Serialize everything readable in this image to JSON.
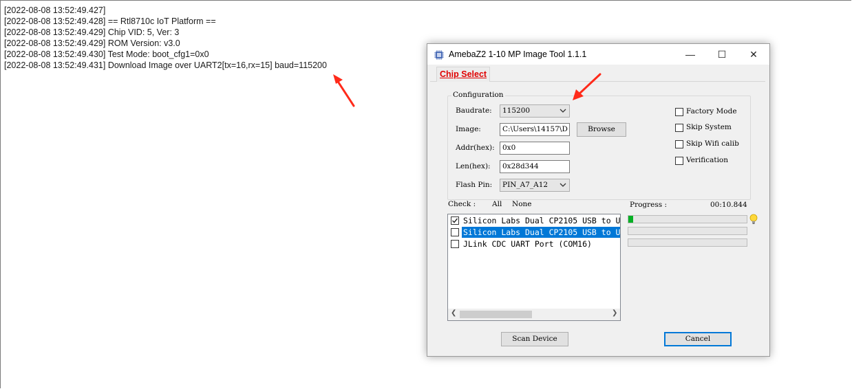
{
  "console": {
    "lines": [
      "[2022-08-08 13:52:49.427]",
      "[2022-08-08 13:52:49.428] == Rtl8710c IoT Platform ==",
      "[2022-08-08 13:52:49.429] Chip VID: 5, Ver: 3",
      "[2022-08-08 13:52:49.429] ROM Version: v3.0",
      "[2022-08-08 13:52:49.430] Test Mode: boot_cfg1=0x0",
      "[2022-08-08 13:52:49.431] Download Image over UART2[tx=16,rx=15] baud=115200"
    ]
  },
  "dialog": {
    "title": "AmebaZ2 1-10 MP Image Tool 1.1.1",
    "minimize": "—",
    "maximize": "☐",
    "close": "✕",
    "tab": "Chip Select",
    "config": {
      "title": "Configuration",
      "baudrate_label": "Baudrate:",
      "baudrate_value": "115200",
      "image_label": "Image:",
      "image_value": "C:\\Users\\14157\\D",
      "browse_label": "Browse",
      "addr_label": "Addr(hex):",
      "addr_value": "0x0",
      "len_label": "Len(hex):",
      "len_value": "0x28d344",
      "flashpin_label": "Flash Pin:",
      "flashpin_value": "PIN_A7_A12",
      "options": [
        {
          "label": "Factory Mode",
          "checked": false
        },
        {
          "label": "Skip System",
          "checked": false
        },
        {
          "label": "Skip Wifi calib",
          "checked": false
        },
        {
          "label": "Verification",
          "checked": false
        }
      ]
    },
    "check_label": "Check :",
    "check_all": "All",
    "check_none": "None",
    "progress_label": "Progress :",
    "progress_time": "00:10.844",
    "devices": [
      {
        "label": "Silicon Labs Dual CP2105 USB to U",
        "checked": true,
        "selected": false,
        "progress": 0.04
      },
      {
        "label": "Silicon Labs Dual CP2105 USB to U",
        "checked": false,
        "selected": true,
        "progress": 0
      },
      {
        "label": "JLink CDC UART Port (COM16)",
        "checked": false,
        "selected": false,
        "progress": 0
      }
    ],
    "scan_label": "Scan Device",
    "cancel_label": "Cancel"
  },
  "colors": {
    "accent": "#0078d7",
    "tab_text": "#e00000",
    "arrow": "#ff2a1a",
    "progress": "#06b025"
  }
}
